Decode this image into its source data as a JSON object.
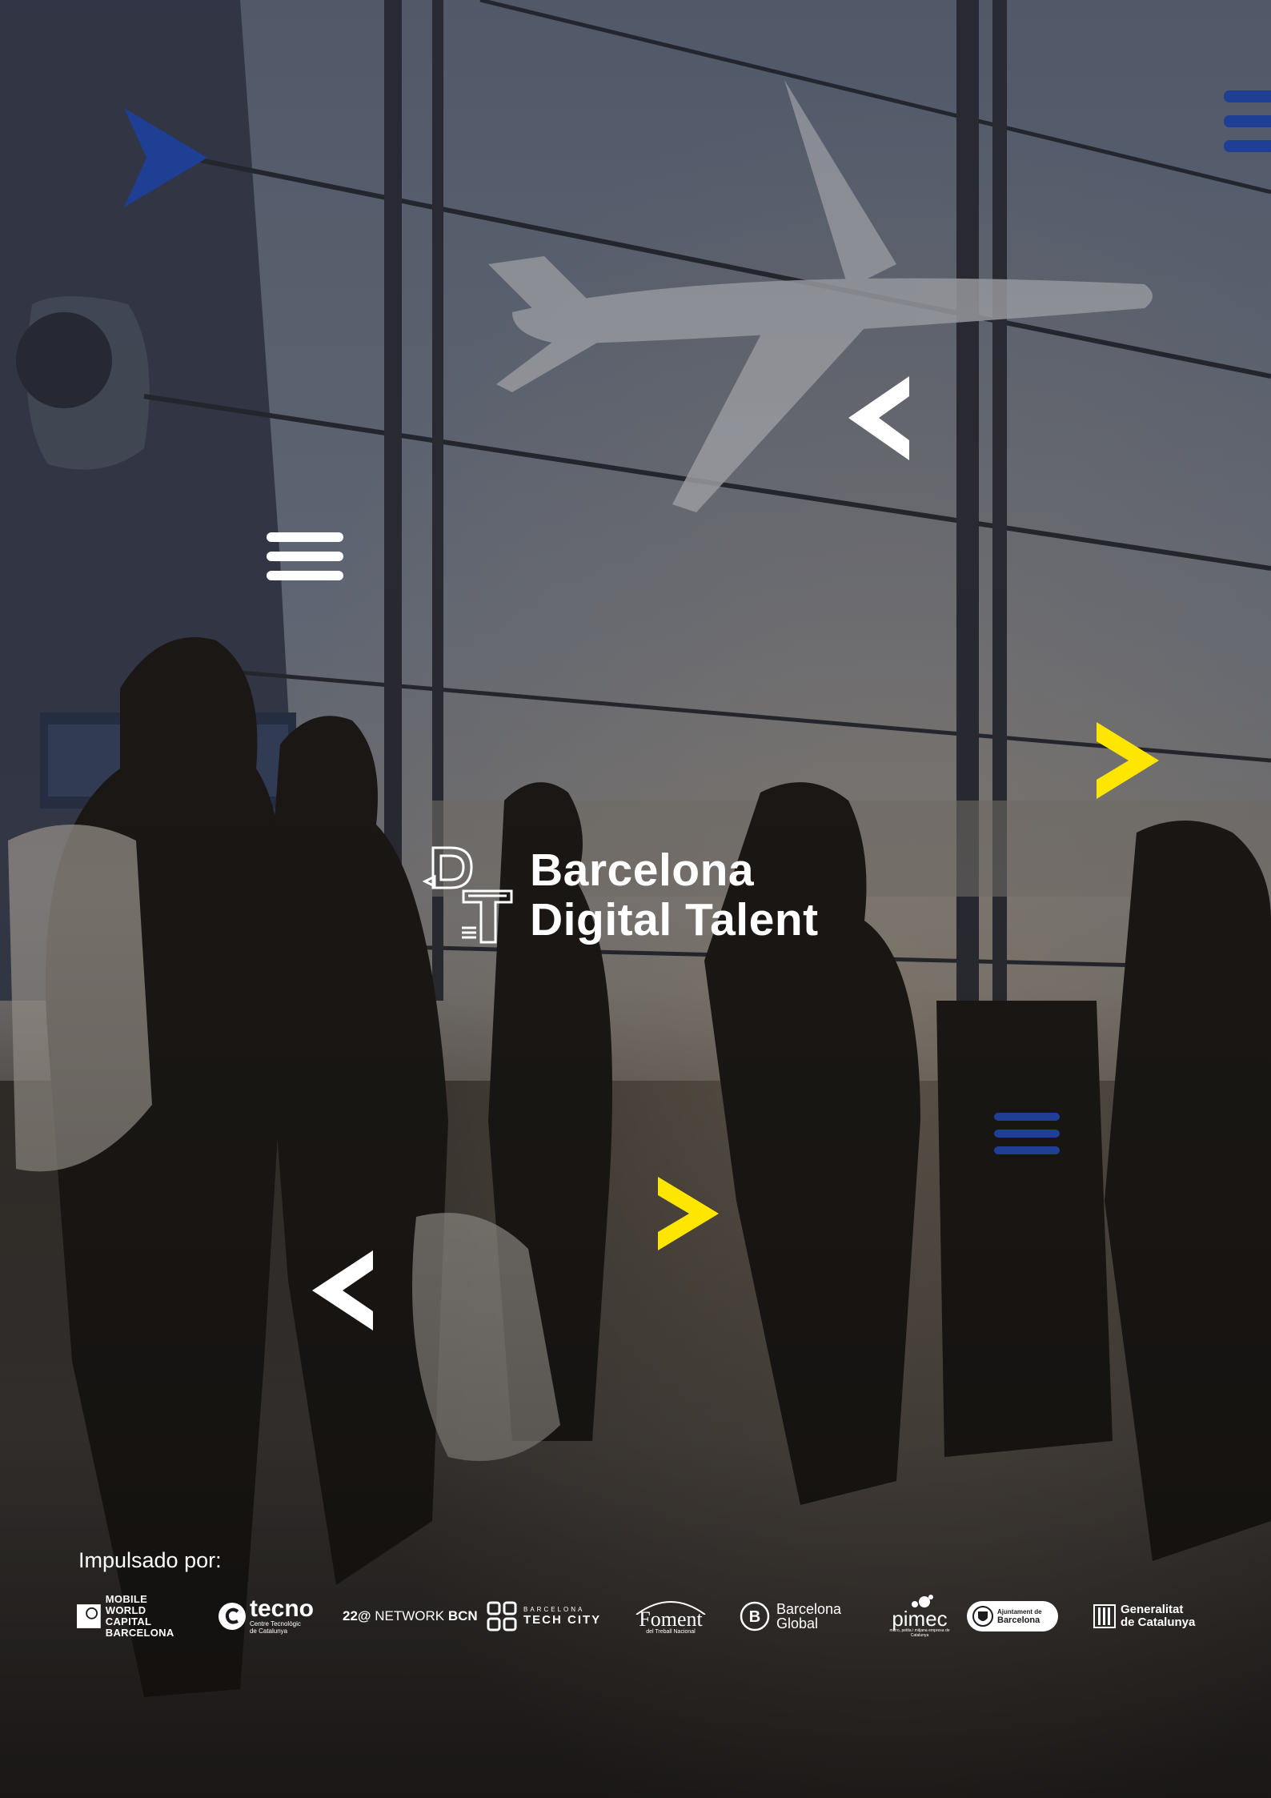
{
  "brand": {
    "line1": "Barcelona",
    "line2": "Digital Talent"
  },
  "sponsors_label": "Impulsado por:",
  "sponsors": {
    "mwc": {
      "l1": "MOBILE",
      "l2": "WORLD CAPITAL",
      "l3": "BARCELONA"
    },
    "tecno": {
      "name": "tecno",
      "l1": "Centre Tecnològic",
      "l2": "de Catalunya"
    },
    "network": {
      "prefix": "22@",
      "middle": " NETWORK ",
      "suffix": "BCN"
    },
    "techcity": {
      "l1": "BARCELONA",
      "l2": "TECH CITY"
    },
    "foment": {
      "name": "Foment",
      "sub": "del Treball Nacional"
    },
    "bglobal": {
      "l1": "Barcelona",
      "l2": "Global"
    },
    "pimec": {
      "name": "pimec",
      "sub": "micro, petita i mitjana empresa de Catalunya"
    },
    "ajuntament": {
      "l1": "Ajuntament de",
      "l2": "Barcelona"
    },
    "generalitat": {
      "l1": "Generalitat",
      "l2": "de Catalunya"
    }
  },
  "colors": {
    "blue": "#1f3f94",
    "yellow": "#ffe600",
    "white": "#ffffff"
  },
  "icons": [
    "chevron-right-icon",
    "chevron-left-icon",
    "hamburger-menu-icon"
  ]
}
